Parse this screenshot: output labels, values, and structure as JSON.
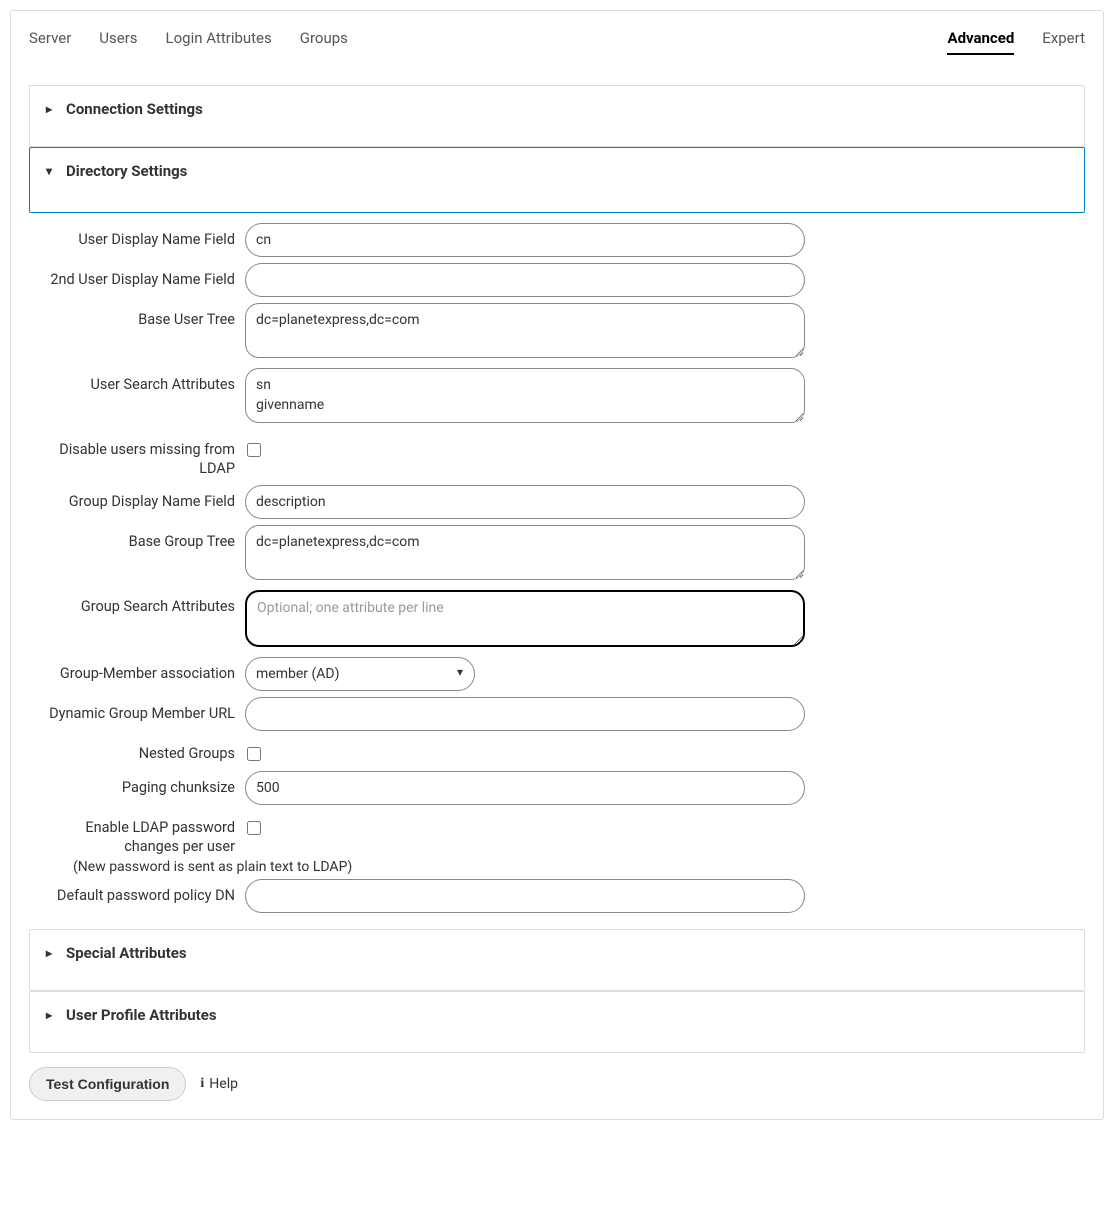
{
  "tabs": {
    "left": [
      "Server",
      "Users",
      "Login Attributes",
      "Groups"
    ],
    "right": [
      "Advanced",
      "Expert"
    ],
    "active": "Advanced"
  },
  "sections": {
    "connection": {
      "title": "Connection Settings"
    },
    "directory": {
      "title": "Directory Settings",
      "fields": {
        "user_display_name": {
          "label": "User Display Name Field",
          "value": "cn"
        },
        "user_display_name_2": {
          "label": "2nd User Display Name Field",
          "value": ""
        },
        "base_user_tree": {
          "label": "Base User Tree",
          "value": "dc=planetexpress,dc=com"
        },
        "user_search_attributes": {
          "label": "User Search Attributes",
          "value": "sn\ngivenname"
        },
        "disable_missing_users": {
          "label": "Disable users missing from LDAP",
          "checked": false
        },
        "group_display_name": {
          "label": "Group Display Name Field",
          "value": "description"
        },
        "base_group_tree": {
          "label": "Base Group Tree",
          "value": "dc=planetexpress,dc=com"
        },
        "group_search_attributes": {
          "label": "Group Search Attributes",
          "value": "",
          "placeholder": "Optional; one attribute per line"
        },
        "group_member_assoc": {
          "label": "Group-Member association",
          "value": "member (AD)"
        },
        "dynamic_group_url": {
          "label": "Dynamic Group Member URL",
          "value": ""
        },
        "nested_groups": {
          "label": "Nested Groups",
          "checked": false
        },
        "paging_chunksize": {
          "label": "Paging chunksize",
          "value": "500"
        },
        "enable_ldap_pwd": {
          "label": "Enable LDAP password changes per user",
          "checked": false,
          "helper": "(New password is sent as plain text to LDAP)"
        },
        "default_pwd_policy": {
          "label": "Default password policy DN",
          "value": ""
        }
      }
    },
    "special": {
      "title": "Special Attributes"
    },
    "user_profile": {
      "title": "User Profile Attributes"
    }
  },
  "footer": {
    "test_config": "Test Configuration",
    "help": "Help"
  }
}
